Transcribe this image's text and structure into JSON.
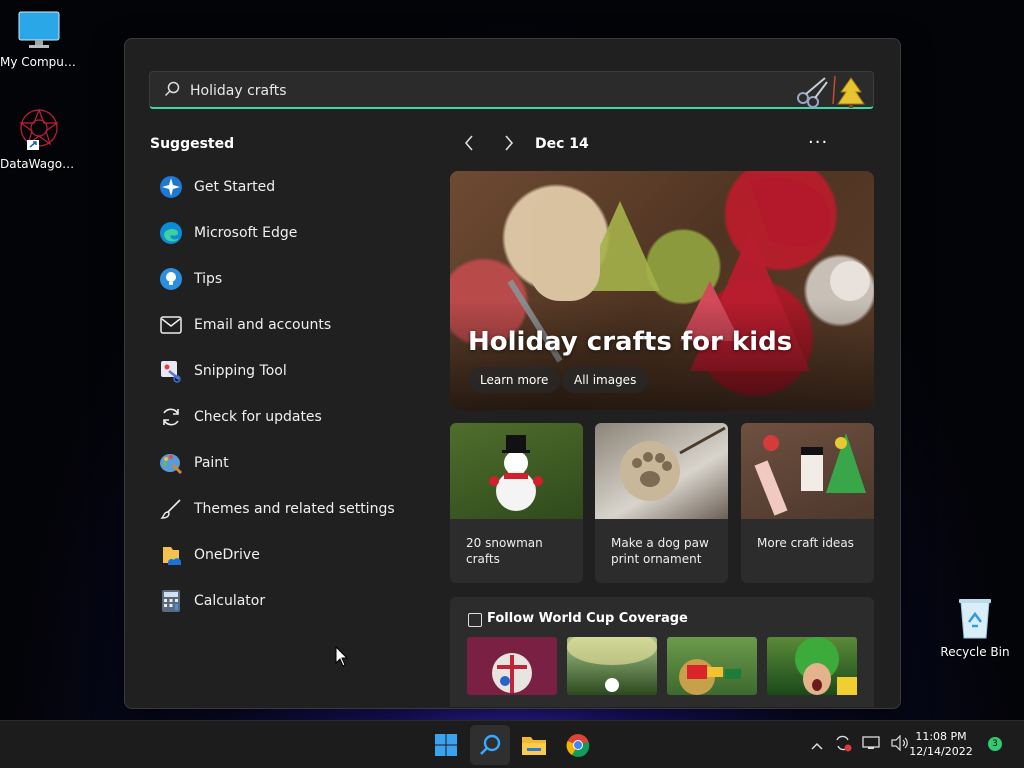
{
  "desktop": {
    "icons": [
      {
        "label": "My Computer",
        "icon": "monitor-icon"
      },
      {
        "label": "DataWagon...",
        "icon": "datawagon-shortcut-icon"
      },
      {
        "label": "Recycle Bin",
        "icon": "recycle-bin-icon"
      }
    ]
  },
  "search": {
    "query": "Holiday crafts",
    "accent_color": "#3fd6a8"
  },
  "suggested": {
    "title": "Suggested",
    "items": [
      {
        "label": "Get Started",
        "icon": "get-started-icon"
      },
      {
        "label": "Microsoft Edge",
        "icon": "edge-icon"
      },
      {
        "label": "Tips",
        "icon": "tips-icon"
      },
      {
        "label": "Email and accounts",
        "icon": "mail-icon"
      },
      {
        "label": "Snipping Tool",
        "icon": "snipping-tool-icon"
      },
      {
        "label": "Check for updates",
        "icon": "refresh-icon"
      },
      {
        "label": "Paint",
        "icon": "paint-icon"
      },
      {
        "label": "Themes and related settings",
        "icon": "brush-icon"
      },
      {
        "label": "OneDrive",
        "icon": "onedrive-icon"
      },
      {
        "label": "Calculator",
        "icon": "calculator-icon"
      }
    ]
  },
  "highlights": {
    "date": "Dec 14",
    "more_label": "···",
    "hero": {
      "title": "Holiday crafts for kids",
      "learn_more": "Learn more",
      "all_images": "All images"
    },
    "cards": [
      {
        "text": "20 snowman crafts"
      },
      {
        "text": "Make a dog paw print ornament"
      },
      {
        "text": "More craft ideas"
      }
    ],
    "world_cup": {
      "title": "Follow World Cup Coverage"
    }
  },
  "taskbar": {
    "apps": [
      "windows-start-icon",
      "search-icon",
      "file-explorer-icon",
      "chrome-icon"
    ],
    "time": "11:08 PM",
    "date": "12/14/2022",
    "notification_count": "3"
  }
}
